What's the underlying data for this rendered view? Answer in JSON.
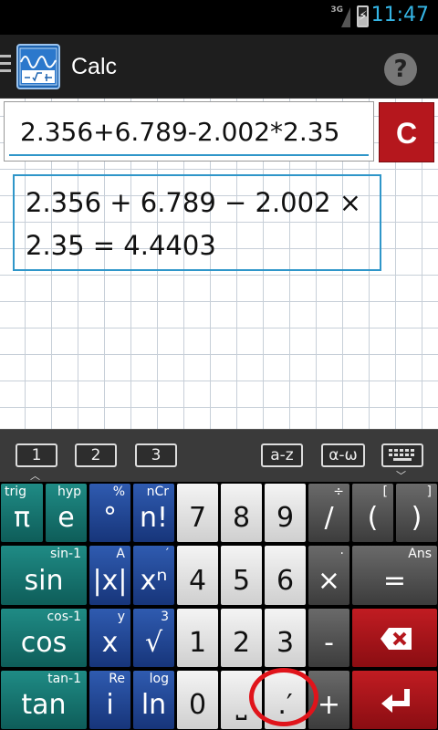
{
  "status": {
    "network": "3G",
    "time": "11:47",
    "battery_level": 0.5
  },
  "app": {
    "title": "Calc",
    "help_label": "?"
  },
  "input": {
    "expression": "2.356+6.789-2.002*2.35",
    "clear_label": "C"
  },
  "result": {
    "line1": "2.356 + 6.789 − 2.002 ×",
    "line2": "2.35 = 4.4403"
  },
  "kbtabs": {
    "t1": "1",
    "t2": "2",
    "t3": "3",
    "az": "a-z",
    "greek": "α-ω"
  },
  "keys": {
    "pi": {
      "main": "π",
      "sup": "trig"
    },
    "e": {
      "main": "e",
      "sup": "hyp"
    },
    "deg": {
      "main": "°",
      "sup": "%"
    },
    "fact": {
      "main": "n!",
      "sup": "nCr"
    },
    "sin": {
      "main": "sin",
      "sup": "sin-1"
    },
    "abs": {
      "main": "|x|",
      "sup": "A"
    },
    "pow": {
      "main": "xⁿ",
      "sup": "′"
    },
    "cos": {
      "main": "cos",
      "sup": "cos-1"
    },
    "x": {
      "main": "x",
      "sup": "y"
    },
    "sqrt": {
      "main": "√",
      "sup": "3"
    },
    "tan": {
      "main": "tan",
      "sup": "tan-1"
    },
    "i": {
      "main": "i",
      "sup": "Re"
    },
    "ln": {
      "main": "ln",
      "sup": "log"
    },
    "n7": "7",
    "n8": "8",
    "n9": "9",
    "n4": "4",
    "n5": "5",
    "n6": "6",
    "n1": "1",
    "n2": "2",
    "n3": "3",
    "n0": "0",
    "space": "⎵",
    "dot": ".′",
    "div": {
      "main": "/",
      "sup": "÷"
    },
    "lpar": {
      "main": "(",
      "sup": "["
    },
    "rpar": {
      "main": ")",
      "sup": "]"
    },
    "mul": {
      "main": "×",
      "sup": "·"
    },
    "eq": {
      "main": "=",
      "sup": "Ans"
    },
    "minus": "-",
    "plus": "+"
  },
  "colors": {
    "accent": "#2f96c9",
    "clear": "#b5171d",
    "highlight_circle": "#e0141b"
  }
}
